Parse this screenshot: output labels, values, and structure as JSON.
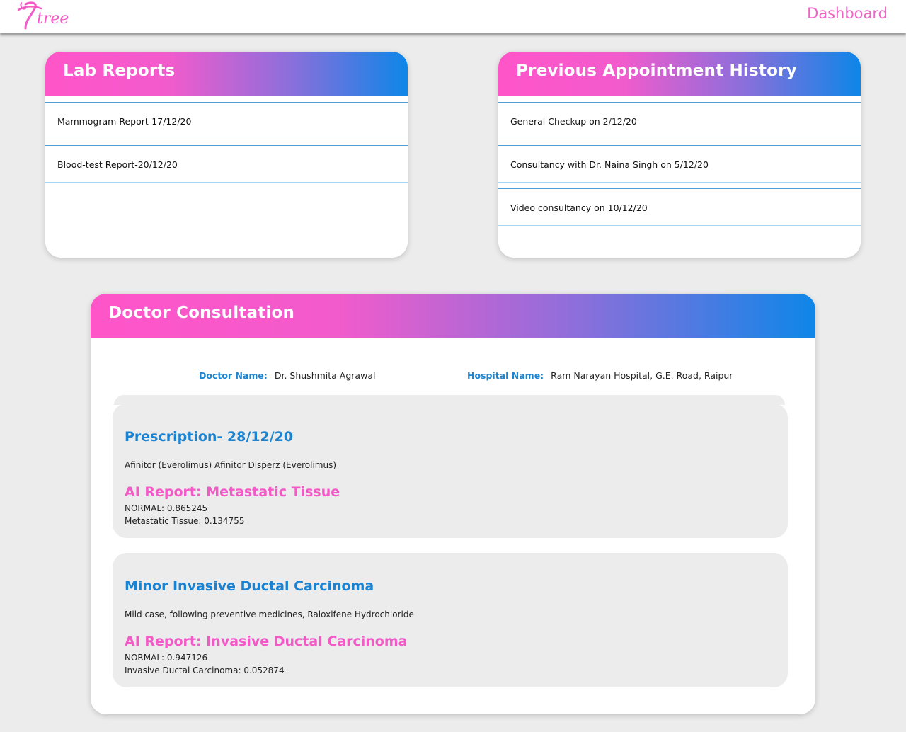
{
  "header": {
    "logo_text": "tree",
    "dashboard_link": "Dashboard"
  },
  "lab_reports": {
    "title": "Lab Reports",
    "items": [
      "Mammogram Report-17/12/20",
      "Blood-test Report-20/12/20"
    ]
  },
  "appointment_history": {
    "title": "Previous Appointment History",
    "items": [
      "General Checkup on 2/12/20",
      "Consultancy with Dr. Naina Singh on 5/12/20",
      "Video consultancy on 10/12/20"
    ]
  },
  "consultation": {
    "title": "Doctor Consultation",
    "doctor_label": "Doctor Name:",
    "doctor_value": "Dr. Shushmita Agrawal",
    "hospital_label": "Hospital Name:",
    "hospital_value": "Ram Narayan Hospital, G.E. Road, Raipur",
    "records": [
      {
        "title": "Prescription- 28/12/20",
        "description": "Afinitor (Everolimus) Afinitor Disperz (Everolimus)",
        "ai_title": "AI Report: Metastatic Tissue",
        "line1": "NORMAL: 0.865245",
        "line2": "Metastatic Tissue: 0.134755"
      },
      {
        "title": "Minor Invasive Ductal Carcinoma",
        "description": "Mild case, following preventive medicines, Raloxifene Hydrochloride",
        "ai_title": "AI Report: Invasive Ductal Carcinoma",
        "line1": "NORMAL: 0.947126",
        "line2": "Invasive Ductal Carcinoma: 0.052874"
      }
    ]
  },
  "colors": {
    "pink": "#f25ac6",
    "blue": "#1a82d0",
    "gradient_start": "#ff55c9",
    "gradient_end": "#0e86e8"
  }
}
